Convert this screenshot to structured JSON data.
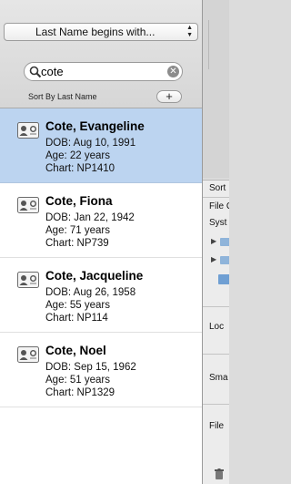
{
  "filter": {
    "label": "Last Name begins with..."
  },
  "search": {
    "value": "cote"
  },
  "sort_label": "Sort By Last Name",
  "add_label": "+",
  "patients": [
    {
      "name": "Cote, Evangeline",
      "dob": "DOB: Aug 10, 1991",
      "age": "Age: 22 years",
      "chart": "Chart: NP1410",
      "selected": true
    },
    {
      "name": "Cote, Fiona",
      "dob": "DOB: Jan 22, 1942",
      "age": "Age: 71 years",
      "chart": "Chart: NP739",
      "selected": false
    },
    {
      "name": "Cote, Jacqueline",
      "dob": "DOB: Aug 26, 1958",
      "age": "Age: 55 years",
      "chart": "Chart: NP114",
      "selected": false
    },
    {
      "name": "Cote, Noel",
      "dob": "DOB: Sep 15, 1962",
      "age": "Age: 51 years",
      "chart": "Chart: NP1329",
      "selected": false
    }
  ],
  "right_pane": {
    "sort": "Sort",
    "file": "File C",
    "system": "Syst",
    "local": "Loc",
    "small": "Sma",
    "file2": "File"
  },
  "colors": {
    "selection": "#bcd4f0",
    "folder": "#8fb4da"
  },
  "icons": [
    "search-icon",
    "clear-icon",
    "contact-card-icon",
    "folder-icon",
    "disclosure-triangle-icon",
    "trash-icon"
  ]
}
